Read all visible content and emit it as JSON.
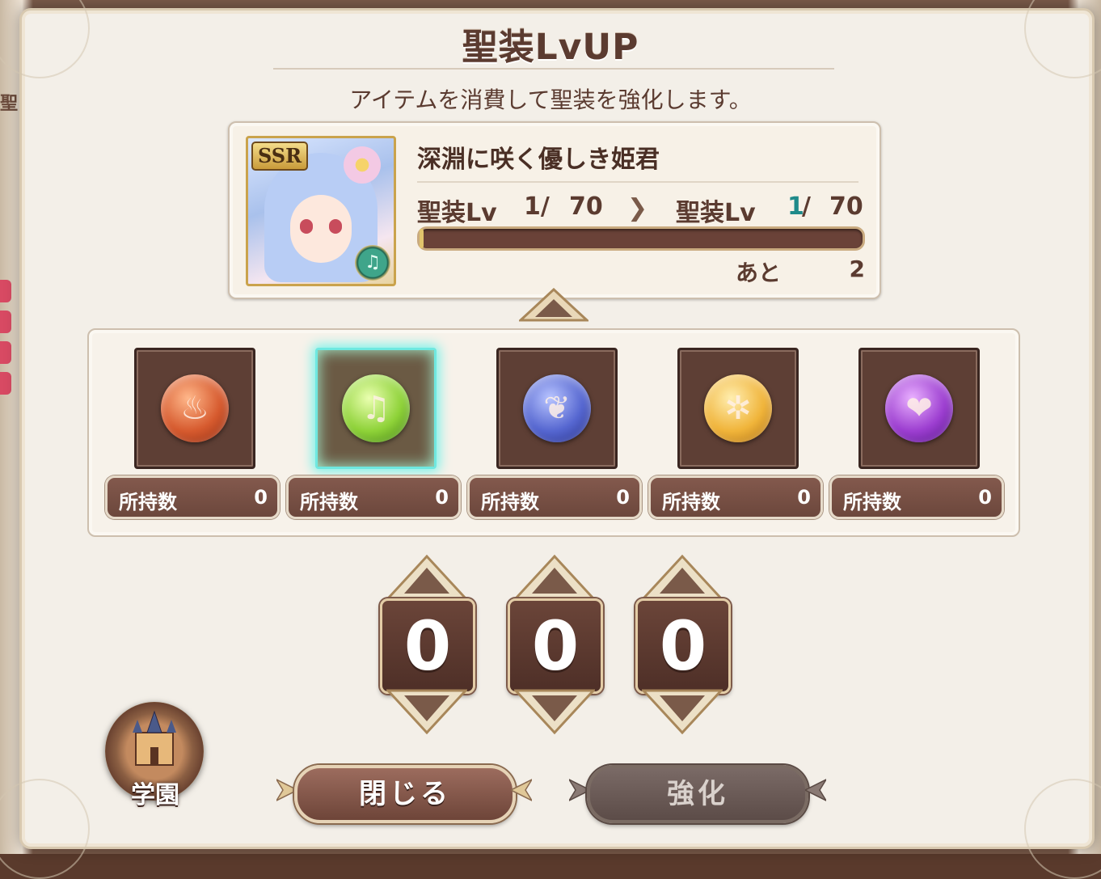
{
  "dialog": {
    "title": "聖装LvUP",
    "subtitle": "アイテムを消費して聖装を強化します。"
  },
  "character": {
    "rarity": "SSR",
    "name": "深淵に咲く優しき姫君",
    "type_icon": "harp-icon",
    "level_label": "聖装Lv",
    "current_level": "1/",
    "current_max": "70",
    "next_level_label": "聖装Lv",
    "next_level": "1",
    "next_slash": "/",
    "next_max": "70",
    "exp_progress": 0.01,
    "remaining_label": "あと",
    "remaining_value": "2"
  },
  "items": [
    {
      "icon": "fire-orb-icon",
      "color": "#e0673a",
      "owned_label": "所持数",
      "owned": "0",
      "selected": false
    },
    {
      "icon": "harp-orb-icon",
      "color": "#8fd63a",
      "owned_label": "所持数",
      "owned": "0",
      "selected": true
    },
    {
      "icon": "water-orb-icon",
      "color": "#5a6fd8",
      "owned_label": "所持数",
      "owned": "0",
      "selected": false
    },
    {
      "icon": "light-orb-icon",
      "color": "#f2b23a",
      "owned_label": "所持数",
      "owned": "0",
      "selected": false
    },
    {
      "icon": "dark-orb-icon",
      "color": "#a04ad0",
      "owned_label": "所持数",
      "owned": "0",
      "selected": false
    }
  ],
  "counter": {
    "digits": [
      "0",
      "0",
      "0"
    ]
  },
  "school_badge": {
    "label": "学園"
  },
  "buttons": {
    "close": "閉じる",
    "enhance": "強化"
  },
  "background": {
    "side_text": "聖"
  }
}
